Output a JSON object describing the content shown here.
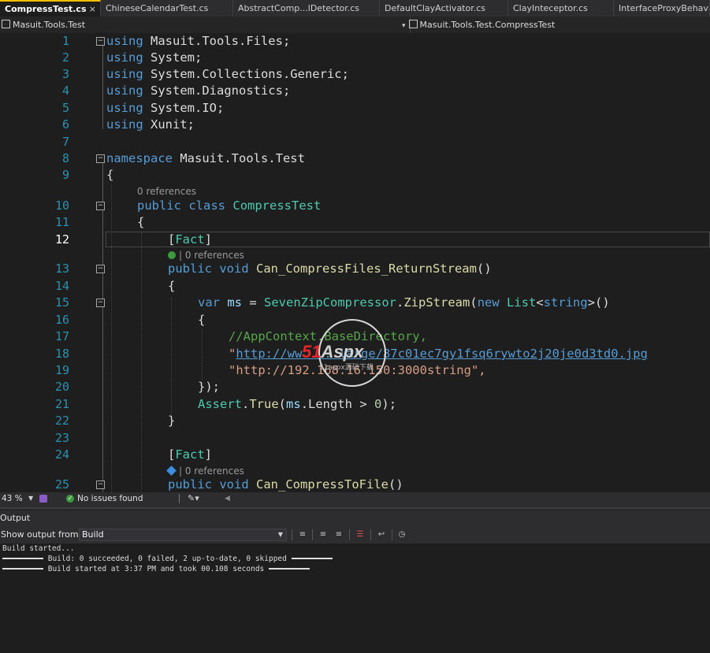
{
  "tabs": [
    {
      "label": "CompressTest.cs",
      "active": true
    },
    {
      "label": "ChineseCalendarTest.cs",
      "active": false
    },
    {
      "label": "AbstractComp...lDetector.cs",
      "active": false
    },
    {
      "label": "DefaultClayActivator.cs",
      "active": false
    },
    {
      "label": "ClayInteceptor.cs",
      "active": false
    },
    {
      "label": "InterfaceProxyBehavior",
      "active": false
    }
  ],
  "tab_close_glyph": "×",
  "navbar": {
    "project": "Masuit.Tools.Test",
    "type": "Masuit.Tools.Test.CompressTest"
  },
  "editor": {
    "line_numbers": [
      "1",
      "2",
      "3",
      "4",
      "5",
      "6",
      "7",
      "8",
      "9",
      "10",
      "11",
      "12",
      "13",
      "14",
      "15",
      "16",
      "17",
      "18",
      "19",
      "20",
      "21",
      "22",
      "23",
      "24",
      "25"
    ],
    "current_line": "12",
    "codelens": {
      "class_refs": "0 references",
      "method1_refs": "| 0 references",
      "method2_refs": "| 0 references"
    },
    "tokens": {
      "using": "using",
      "ns1": " Masuit.Tools.Files;",
      "ns2": " System;",
      "ns3": " System.Collections.Generic;",
      "ns4": " System.Diagnostics;",
      "ns5": " System.IO;",
      "ns6": " Xunit;",
      "namespace": "namespace",
      "namespace_name": " Masuit.Tools.Test",
      "open_brace": "{",
      "close_brace": "}",
      "public": "public",
      "class": "class",
      "void": "void",
      "var": "var",
      "new": "new",
      "string": "string",
      "class_name": "CompressTest",
      "attr_open": "[",
      "attr_name": "Fact",
      "attr_close": "]",
      "method1": "Can_CompressFiles_ReturnStream",
      "method2": "Can_CompressToFile",
      "parens": "()",
      "ms": "ms",
      "assign": " = ",
      "compressor": "SevenZipCompressor",
      "dot": ".",
      "zipstream": "ZipStream",
      "paren_open": "(",
      "list": "List",
      "lt": "<",
      "gt": ">",
      "comment": "//AppContext.BaseDirectory,",
      "str1_quote": "\"",
      "str1_url": "http://ww.....large/87c01ec7gy1fsq6rywto2j20je0d3td0.jpg",
      "str2": "\"http://192.168.16.150:3000string\",",
      "close_call": "});",
      "assert": "Assert",
      "true_fn": "True",
      "length_expr_a": "ms",
      "length_expr_b": ".Length > ",
      "zero": "0",
      "end_stmt": ");"
    }
  },
  "watermark": {
    "brand_51": "51",
    "brand_aspx": "Aspx",
    "sub": "51aspx源码下载"
  },
  "statusbar": {
    "zoom": "43 %",
    "issues": "No issues found"
  },
  "output": {
    "title": "Output",
    "show_from_label": "Show output from:",
    "source": "Build",
    "lines": [
      "Build started...",
      " Build: 0 succeeded, 0 failed, 2 up-to-date, 0 skipped ",
      " Build started at 3:37 PM and took 00.108 seconds "
    ]
  },
  "colors": {
    "background": "#1e1e1e",
    "keyword": "#569cd6",
    "type": "#4ec9b0",
    "method": "#dcdcaa",
    "string": "#d69d85",
    "comment": "#57a64a",
    "line_number": "#2b91af",
    "tab_accent": "#f0c000"
  }
}
